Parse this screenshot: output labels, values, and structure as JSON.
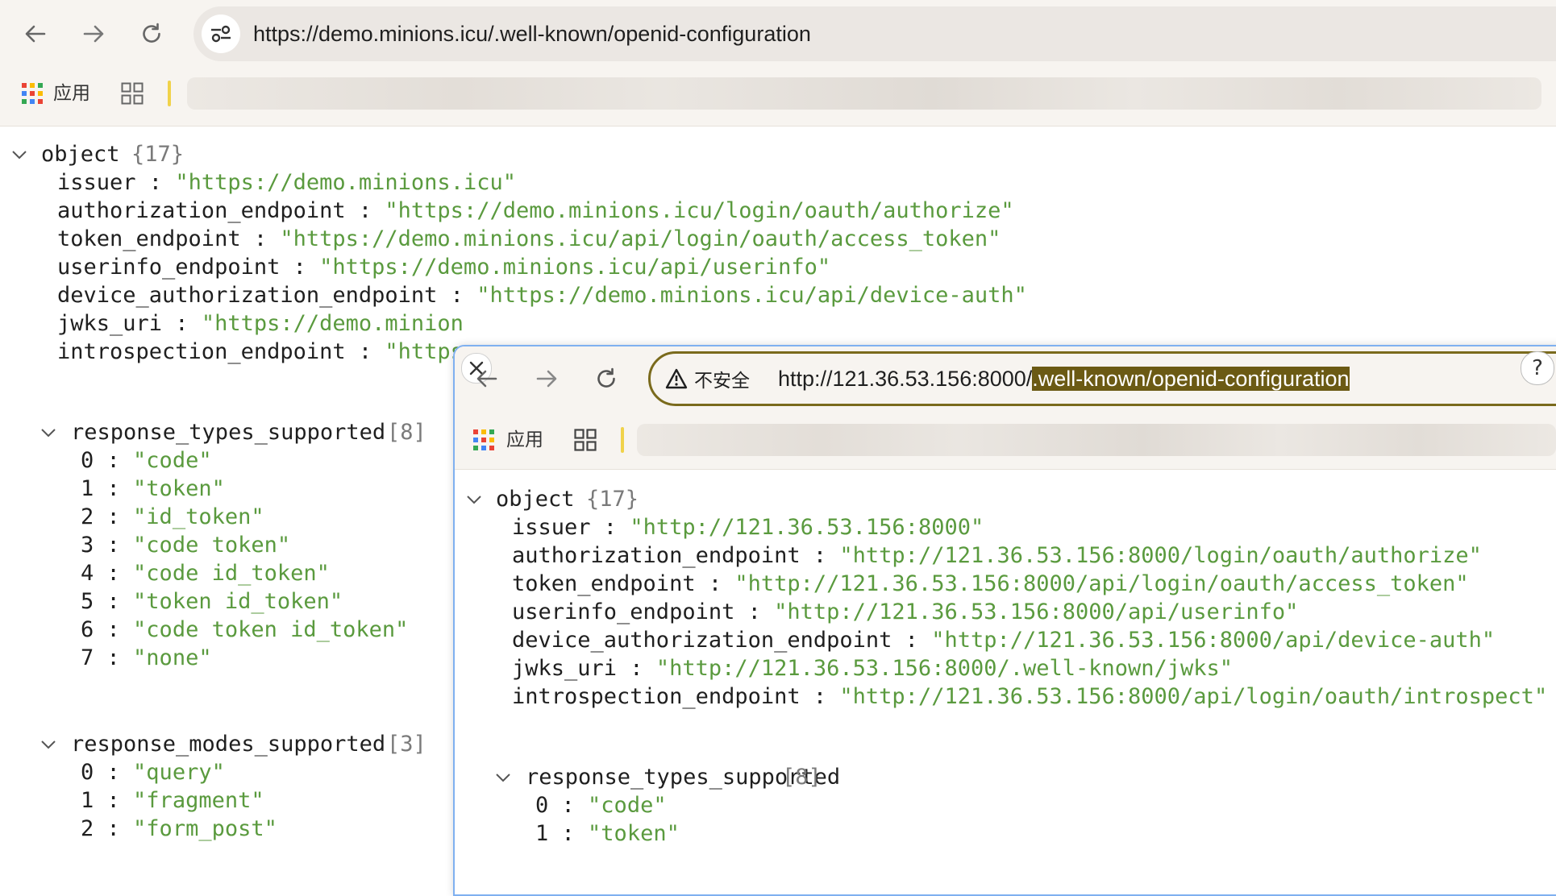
{
  "main": {
    "url": "https://demo.minions.icu/.well-known/openid-configuration",
    "bookmarks": {
      "apps_label": "应用"
    },
    "json": {
      "root_label": "object",
      "root_meta": "{17}",
      "fields": [
        {
          "key": "issuer",
          "value": "\"https://demo.minions.icu\""
        },
        {
          "key": "authorization_endpoint",
          "value": "\"https://demo.minions.icu/login/oauth/authorize\""
        },
        {
          "key": "token_endpoint",
          "value": "\"https://demo.minions.icu/api/login/oauth/access_token\""
        },
        {
          "key": "userinfo_endpoint",
          "value": "\"https://demo.minions.icu/api/userinfo\""
        },
        {
          "key": "device_authorization_endpoint",
          "value": "\"https://demo.minions.icu/api/device-auth\""
        },
        {
          "key": "jwks_uri",
          "value": "\"https://demo.minion"
        },
        {
          "key": "introspection_endpoint",
          "value": "\"https"
        }
      ],
      "response_types": {
        "key": "response_types_supported",
        "meta": "[8]",
        "items": [
          {
            "index": "0",
            "value": "\"code\""
          },
          {
            "index": "1",
            "value": "\"token\""
          },
          {
            "index": "2",
            "value": "\"id_token\""
          },
          {
            "index": "3",
            "value": "\"code token\""
          },
          {
            "index": "4",
            "value": "\"code id_token\""
          },
          {
            "index": "5",
            "value": "\"token id_token\""
          },
          {
            "index": "6",
            "value": "\"code token id_token\""
          },
          {
            "index": "7",
            "value": "\"none\""
          }
        ]
      },
      "response_modes": {
        "key": "response_modes_supported",
        "meta": "[3]",
        "items": [
          {
            "index": "0",
            "value": "\"query\""
          },
          {
            "index": "1",
            "value": "\"fragment\""
          },
          {
            "index": "2",
            "value": "\"form_post\""
          }
        ]
      }
    }
  },
  "overlay": {
    "security_label": "不安全",
    "url_base": "http://121.36.53.156:8000/",
    "url_selected": ".well-known/openid-configuration",
    "help_label": "?",
    "bookmarks": {
      "apps_label": "应用"
    },
    "json": {
      "root_label": "object",
      "root_meta": "{17}",
      "fields": [
        {
          "key": "issuer",
          "value": "\"http://121.36.53.156:8000\""
        },
        {
          "key": "authorization_endpoint",
          "value": "\"http://121.36.53.156:8000/login/oauth/authorize\""
        },
        {
          "key": "token_endpoint",
          "value": "\"http://121.36.53.156:8000/api/login/oauth/access_token\""
        },
        {
          "key": "userinfo_endpoint",
          "value": "\"http://121.36.53.156:8000/api/userinfo\""
        },
        {
          "key": "device_authorization_endpoint",
          "value": "\"http://121.36.53.156:8000/api/device-auth\""
        },
        {
          "key": "jwks_uri",
          "value": "\"http://121.36.53.156:8000/.well-known/jwks\""
        },
        {
          "key": "introspection_endpoint",
          "value": "\"http://121.36.53.156:8000/api/login/oauth/introspect\""
        }
      ],
      "response_types": {
        "key": "response_types_supported",
        "meta": "[8]",
        "items": [
          {
            "index": "0",
            "value": "\"code\""
          },
          {
            "index": "1",
            "value": "\"token\""
          }
        ]
      }
    }
  },
  "colors": {
    "string_value": "#5a9a3e",
    "key": "#1f1f1f",
    "meta": "#7a7a7a",
    "highlight": "#6b5a14",
    "focus_border": "#7fb0f0"
  },
  "icons": {
    "back": "arrow-left-icon",
    "forward": "arrow-right-icon",
    "reload": "reload-icon",
    "site_info": "tune-icon",
    "apps": "apps-grid-icon",
    "tabs": "tab-groups-icon",
    "close": "close-icon",
    "warning": "warning-triangle-icon",
    "help": "help-icon",
    "expand": "chevron-down-icon"
  }
}
